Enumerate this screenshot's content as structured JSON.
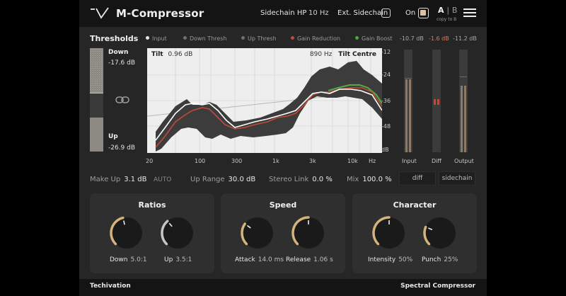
{
  "header": {
    "title": "M-Compressor",
    "sidechain_hp_label": "Sidechain HP",
    "sidechain_hp_value": "10 Hz",
    "ext_sidechain_label": "Ext. Sidechain",
    "on_label": "On",
    "ab_a": "A",
    "ab_sep": "|",
    "ab_b": "B",
    "copy_ab": "copy to B"
  },
  "thresholds": {
    "section_label": "Thresholds",
    "down_label": "Down",
    "down_value": "-17.6 dB",
    "up_label": "Up",
    "up_value": "-26.9 dB",
    "down_level": 0.43,
    "up_level": 0.67
  },
  "legend": [
    {
      "label": "Input",
      "color": "#e6e6e6"
    },
    {
      "label": "Down Thresh",
      "color": "#6f6f6f"
    },
    {
      "label": "Up Thresh",
      "color": "#6f6f6f"
    },
    {
      "label": "Gain Reduction",
      "color": "#c24a36"
    },
    {
      "label": "Gain Boost",
      "color": "#4fa544"
    }
  ],
  "meters_top": {
    "input": "-10.7 dB",
    "diff": "-1.6 dB",
    "output": "-11.2 dB",
    "diff_color": "#d77a5f"
  },
  "graph": {
    "tilt_label": "Tilt",
    "tilt_value": "0.96 dB",
    "centre_value": "890 Hz",
    "centre_label": "Tilt Centre",
    "freq_labels": [
      "20",
      "100",
      "300",
      "1k",
      "3k",
      "10k",
      "Hz"
    ],
    "db_labels": [
      "-12",
      "-24",
      "-36",
      "-48",
      "dB"
    ]
  },
  "meters": {
    "input_label": "Input",
    "diff_label": "Diff",
    "output_label": "Output"
  },
  "params": {
    "makeup_label": "Make Up",
    "makeup_value": "3.1 dB",
    "auto_label": "AUTO",
    "uprange_label": "Up Range",
    "uprange_value": "30.0 dB",
    "stereolink_label": "Stereo Link",
    "stereolink_value": "0.0 %",
    "mix_label": "Mix",
    "mix_value": "100.0 %",
    "diff_button": "diff",
    "sidechain_button": "sidechain"
  },
  "panels": {
    "ratios": {
      "title": "Ratios",
      "down_label": "Down",
      "down_value": "5.0:1",
      "up_label": "Up",
      "up_value": "3.5:1",
      "down_level": 0.45,
      "up_level": 0.35
    },
    "speed": {
      "title": "Speed",
      "attack_label": "Attack",
      "attack_value": "14.0 ms",
      "release_label": "Release",
      "release_value": "1.06 s",
      "attack_level": 0.3,
      "release_level": 0.5
    },
    "character": {
      "title": "Character",
      "intensity_label": "Intensity",
      "intensity_value": "50%",
      "punch_label": "Punch",
      "punch_value": "25%",
      "intensity_level": 0.5,
      "punch_level": 0.25
    }
  },
  "footer": {
    "brand": "Techivation",
    "product": "Spectral Compressor"
  },
  "colors": {
    "accent": "#d9c39a",
    "knob_track": "#141414",
    "knob_gold": "#d4b47a",
    "knob_silver": "#c6c6c6"
  }
}
